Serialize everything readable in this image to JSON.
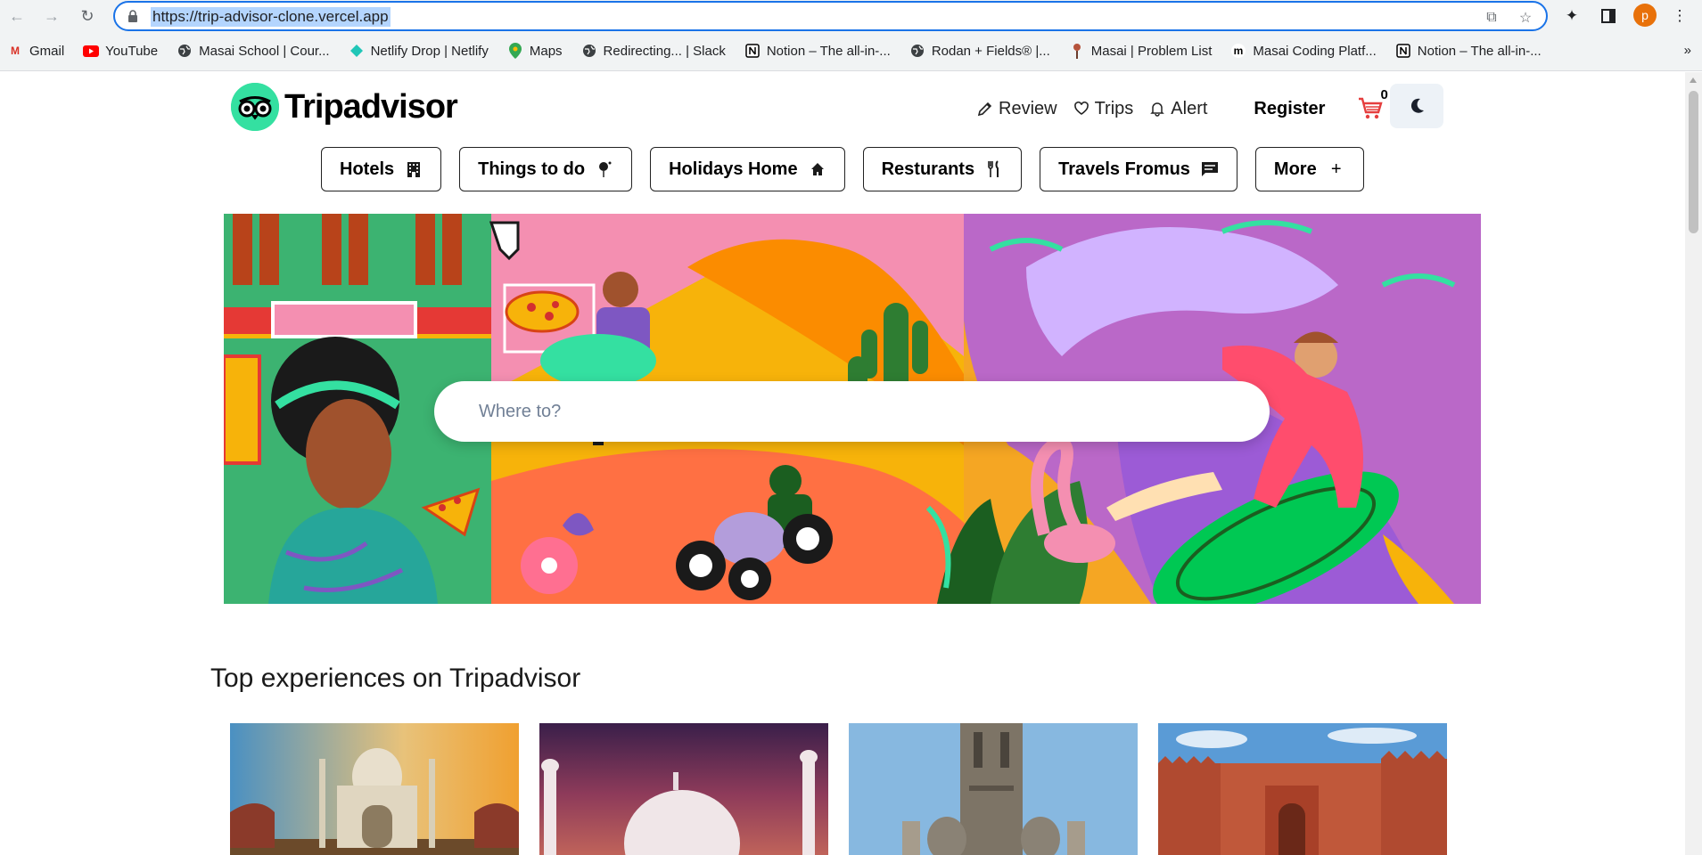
{
  "browser": {
    "url": "https://trip-advisor-clone.vercel.app",
    "profile_initial": "p",
    "bookmarks": [
      {
        "label": "Gmail",
        "icon": "gmail-icon"
      },
      {
        "label": "YouTube",
        "icon": "youtube-icon"
      },
      {
        "label": "Masai School | Cour...",
        "icon": "globe-icon"
      },
      {
        "label": "Netlify Drop | Netlify",
        "icon": "netlify-icon"
      },
      {
        "label": "Maps",
        "icon": "maps-icon"
      },
      {
        "label": "Redirecting... | Slack",
        "icon": "globe-icon"
      },
      {
        "label": "Notion – The all-in-...",
        "icon": "notion-icon"
      },
      {
        "label": "Rodan + Fields® |...",
        "icon": "globe-icon"
      },
      {
        "label": "Masai | Problem List",
        "icon": "masai-icon"
      },
      {
        "label": "Masai Coding Platf...",
        "icon": "masai-m-icon"
      },
      {
        "label": "Notion – The all-in-...",
        "icon": "notion-icon"
      }
    ],
    "more_bookmarks": "»"
  },
  "header": {
    "logo_text": "Tripadvisor",
    "review": "Review",
    "trips": "Trips",
    "alert": "Alert",
    "register": "Register",
    "cart_count": "0"
  },
  "categories": [
    {
      "label": "Hotels",
      "icon": "building-icon"
    },
    {
      "label": "Things to do",
      "icon": "balloon-icon"
    },
    {
      "label": "Holidays Home",
      "icon": "home-icon"
    },
    {
      "label": "Resturants",
      "icon": "fork-knife-icon"
    },
    {
      "label": "Travels Fromus",
      "icon": "chat-icon"
    },
    {
      "label": "More",
      "icon": "plus-icon"
    }
  ],
  "search": {
    "placeholder": "Where to?"
  },
  "section": {
    "title": "Top experiences on Tripadvisor"
  },
  "colors": {
    "brand_green": "#34e0a1",
    "accent_blue": "#1a73e8"
  }
}
